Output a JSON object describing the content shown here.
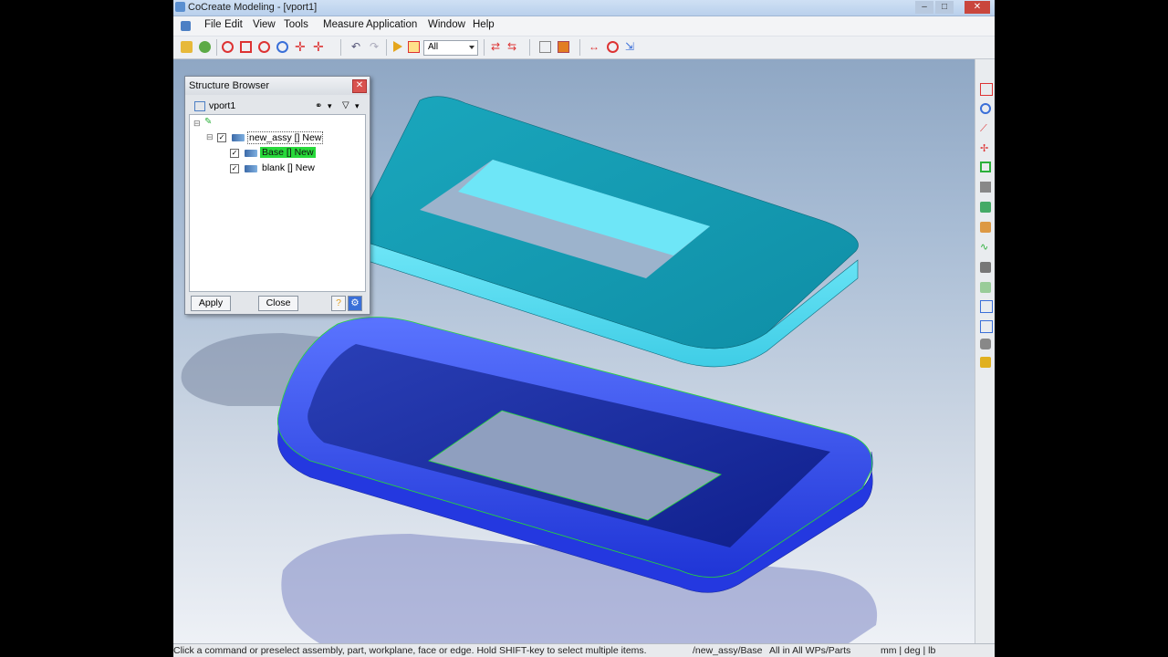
{
  "window": {
    "title": "CoCreate Modeling - [vport1]"
  },
  "menu": [
    "File",
    "Edit",
    "View",
    "Tools",
    "Measure",
    "Application",
    "Window",
    "Help"
  ],
  "toolbar": {
    "filter_value": "All"
  },
  "structure_browser": {
    "title": "Structure Browser",
    "viewport": "vport1",
    "tree": [
      {
        "label": "new_assy [] New",
        "level": 0,
        "selected": false
      },
      {
        "label": "Base [] New",
        "level": 1,
        "selected": true
      },
      {
        "label": "blank [] New",
        "level": 1,
        "selected": false
      }
    ],
    "apply_label": "Apply",
    "close_label": "Close"
  },
  "status": {
    "message": "Click a command or preselect assembly, part, workplane, face or edge. Hold SHIFT-key to select multiple items.",
    "current": "/new_assy/Base",
    "scope": "All in All WPs/Parts",
    "units": "mm | deg | lb"
  },
  "colors": {
    "top_part": "#2fb5cc",
    "bottom_part": "#1e3bd8",
    "selection": "#27d93a"
  }
}
